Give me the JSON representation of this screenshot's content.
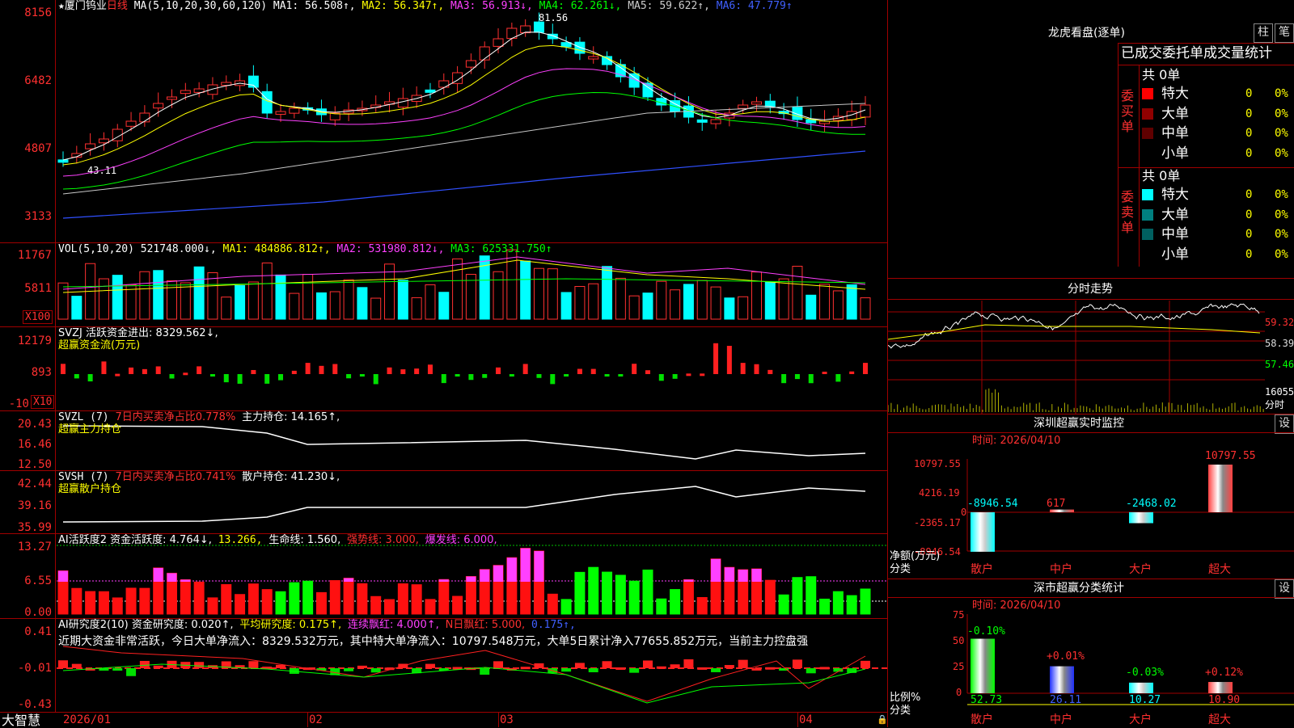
{
  "main": {
    "star": "★",
    "stock_name": "厦门钨业",
    "period": "日线",
    "ma_label": "MA(5,10,20,30,60,120)",
    "ma1": "MA1: 56.508↑,",
    "ma2": "MA2: 56.347↑,",
    "ma3": "MA3: 56.913↓,",
    "ma4": "MA4: 62.261↓,",
    "ma5": "MA5: 59.622↑,",
    "ma6": "MA6: 47.779↑",
    "high_mark": "81.56",
    "low_mark": "43.11",
    "y_ticks": [
      "8156",
      "6482",
      "4807",
      "3133"
    ]
  },
  "vol": {
    "label": "VOL(5,10,20)",
    "value": "521748.000↓,",
    "ma1": "MA1: 484886.812↑,",
    "ma2": "MA2: 531980.812↓,",
    "ma3": "MA3: 625331.750↑",
    "y_ticks": [
      "11767",
      "5811"
    ],
    "unit": "X100"
  },
  "svzj": {
    "label": "SVZJ  活跃资金进出: 8329.562↓,",
    "sub": "超赢资金流(万元)",
    "y_ticks": [
      "12179",
      "893",
      "-10"
    ],
    "unit": "X10"
  },
  "svzl": {
    "label": "SVZL (7)",
    "p1": "7日内买卖净占比0.778%",
    "p2": "主力持仓: 14.165↑,",
    "sub": "超赢主力持仓",
    "y_ticks": [
      "20.43",
      "16.46",
      "12.50"
    ]
  },
  "svsh": {
    "label": "SVSH (7)",
    "p1": "7日内买卖净占比0.741%",
    "p2": "散户持仓: 41.230↓,",
    "sub": "超赢散户持仓",
    "y_ticks": [
      "42.44",
      "39.16",
      "35.99"
    ]
  },
  "ai1": {
    "p1": "AI活跃度2 资金活跃度: 4.764↓,",
    "p2": "13.266,",
    "p3": "生命线: 1.560,",
    "p4": "强势线: 3.000,",
    "p5": "爆发线: 6.000,",
    "y_ticks": [
      "13.27",
      "6.55",
      "0.00"
    ]
  },
  "ai2": {
    "p1": "AI研究度2(10) 资金研究度: 0.020↑,",
    "p2": "平均研究度: 0.175↑,",
    "p3": "连续飘红: 4.000↑,",
    "p4": "N日飘红: 5.000,",
    "p5": "0.175↑,",
    "summary": "近期大资金非常活跃，今日大单净流入：8329.532万元，其中特大单净流入：10797.548万元，大单5日累计净入77655.852万元，当前主力控盘强",
    "y_ticks": [
      "0.41",
      "-0.01",
      "-0.43"
    ]
  },
  "bottom": {
    "brand": "大智慧",
    "dates": [
      "2026/01",
      "02",
      "03",
      "04"
    ]
  },
  "right": {
    "lhb_title": "龙虎看盘(逐单)",
    "btn_bar": "柱",
    "btn_pen": "笔",
    "tabs_title": "已成交委托单成交量统计",
    "buy_side": {
      "label": "委买单",
      "total": "共 0单",
      "rows": [
        {
          "name": "特大",
          "count": "0",
          "pct": "0%",
          "color": "#ff0000"
        },
        {
          "name": "大单",
          "count": "0",
          "pct": "0%",
          "color": "#900000"
        },
        {
          "name": "中单",
          "count": "0",
          "pct": "0%",
          "color": "#600000"
        },
        {
          "name": "小单",
          "count": "0",
          "pct": "0%",
          "color": "#000000"
        }
      ]
    },
    "sell_side": {
      "label": "委卖单",
      "total": "共 0单",
      "rows": [
        {
          "name": "特大",
          "count": "0",
          "pct": "0%",
          "color": "#00ffff"
        },
        {
          "name": "大单",
          "count": "0",
          "pct": "0%",
          "color": "#008080"
        },
        {
          "name": "中单",
          "count": "0",
          "pct": "0%",
          "color": "#006060"
        },
        {
          "name": "小单",
          "count": "0",
          "pct": "0%",
          "color": "#000000"
        }
      ]
    },
    "intraday_title": "分时走势",
    "intraday_ticks": [
      "59.32",
      "58.39",
      "57.46"
    ],
    "intraday_vol": "16055",
    "intraday_vol_unit": "分时",
    "monitor": {
      "title": "深圳超赢实时监控",
      "set_btn": "设",
      "time": "时间: 2026/04/10",
      "y_ticks": [
        "10797.55",
        "4216.19",
        "0",
        "-2365.17",
        "-8946.54"
      ],
      "axis_name": "净额(万元)",
      "axis_cat": "分类",
      "categories": [
        "散户",
        "中户",
        "大户",
        "超大"
      ],
      "values": [
        -8946.54,
        617,
        -2468.02,
        10797.55
      ],
      "value_labels": [
        "-8946.54",
        "617",
        "-2468.02",
        "10797.55"
      ]
    },
    "classify": {
      "title": "深市超赢分类统计",
      "set_btn": "设",
      "time": "时间: 2026/04/10",
      "y_ticks": [
        "75",
        "50",
        "25",
        "0"
      ],
      "axis_name": "比例%",
      "axis_cat": "分类",
      "categories": [
        "散户",
        "中户",
        "大户",
        "超大"
      ],
      "values": [
        52.73,
        26.11,
        10.27,
        10.9
      ],
      "value_labels": [
        "52.73",
        "26.11",
        "10.27",
        "10.90"
      ],
      "changes": [
        "-0.10%",
        "+0.01%",
        "-0.03%",
        "+0.12%"
      ]
    }
  }
}
